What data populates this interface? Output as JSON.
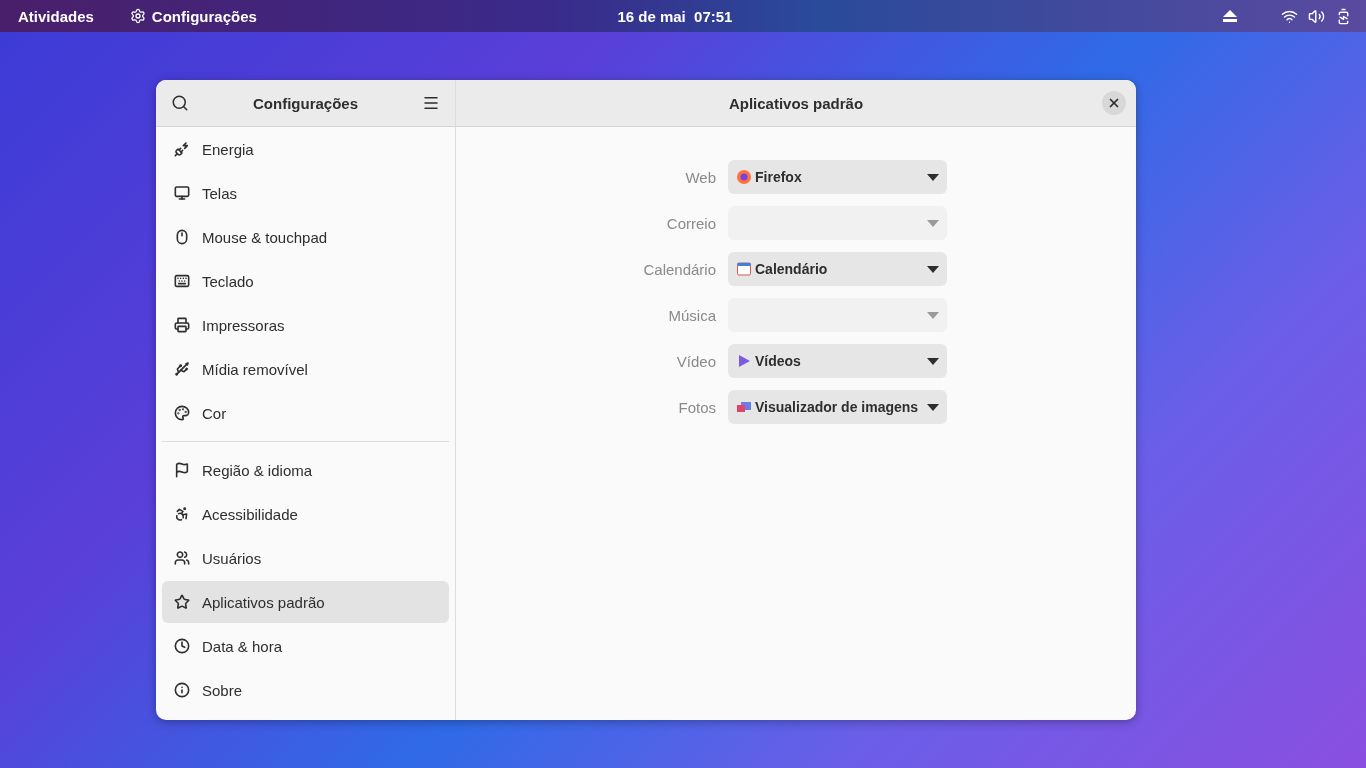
{
  "top_bar": {
    "activities": "Atividades",
    "app_menu": "Configurações",
    "clock": "16 de mai  07:51"
  },
  "window": {
    "sidebar_title": "Configurações",
    "title": "Aplicativos padrão"
  },
  "sidebar": {
    "groups": [
      [
        {
          "label": "Energia",
          "selected": false
        },
        {
          "label": "Telas",
          "selected": false
        },
        {
          "label": "Mouse & touchpad",
          "selected": false
        },
        {
          "label": "Teclado",
          "selected": false
        },
        {
          "label": "Impressoras",
          "selected": false
        },
        {
          "label": "Mídia removível",
          "selected": false
        },
        {
          "label": "Cor",
          "selected": false
        }
      ],
      [
        {
          "label": "Região & idioma",
          "selected": false
        },
        {
          "label": "Acessibilidade",
          "selected": false
        },
        {
          "label": "Usuários",
          "selected": false
        },
        {
          "label": "Aplicativos padrão",
          "selected": true
        },
        {
          "label": "Data & hora",
          "selected": false
        },
        {
          "label": "Sobre",
          "selected": false
        }
      ]
    ]
  },
  "default_apps": [
    {
      "label": "Web",
      "value": "Firefox",
      "disabled": false
    },
    {
      "label": "Correio",
      "disabled": true
    },
    {
      "label": "Calendário",
      "value": "Calendário",
      "disabled": false
    },
    {
      "label": "Música",
      "disabled": true
    },
    {
      "label": "Vídeo",
      "value": "Vídeos",
      "disabled": false
    },
    {
      "label": "Fotos",
      "value": "Visualizador de imagens",
      "disabled": false
    }
  ]
}
